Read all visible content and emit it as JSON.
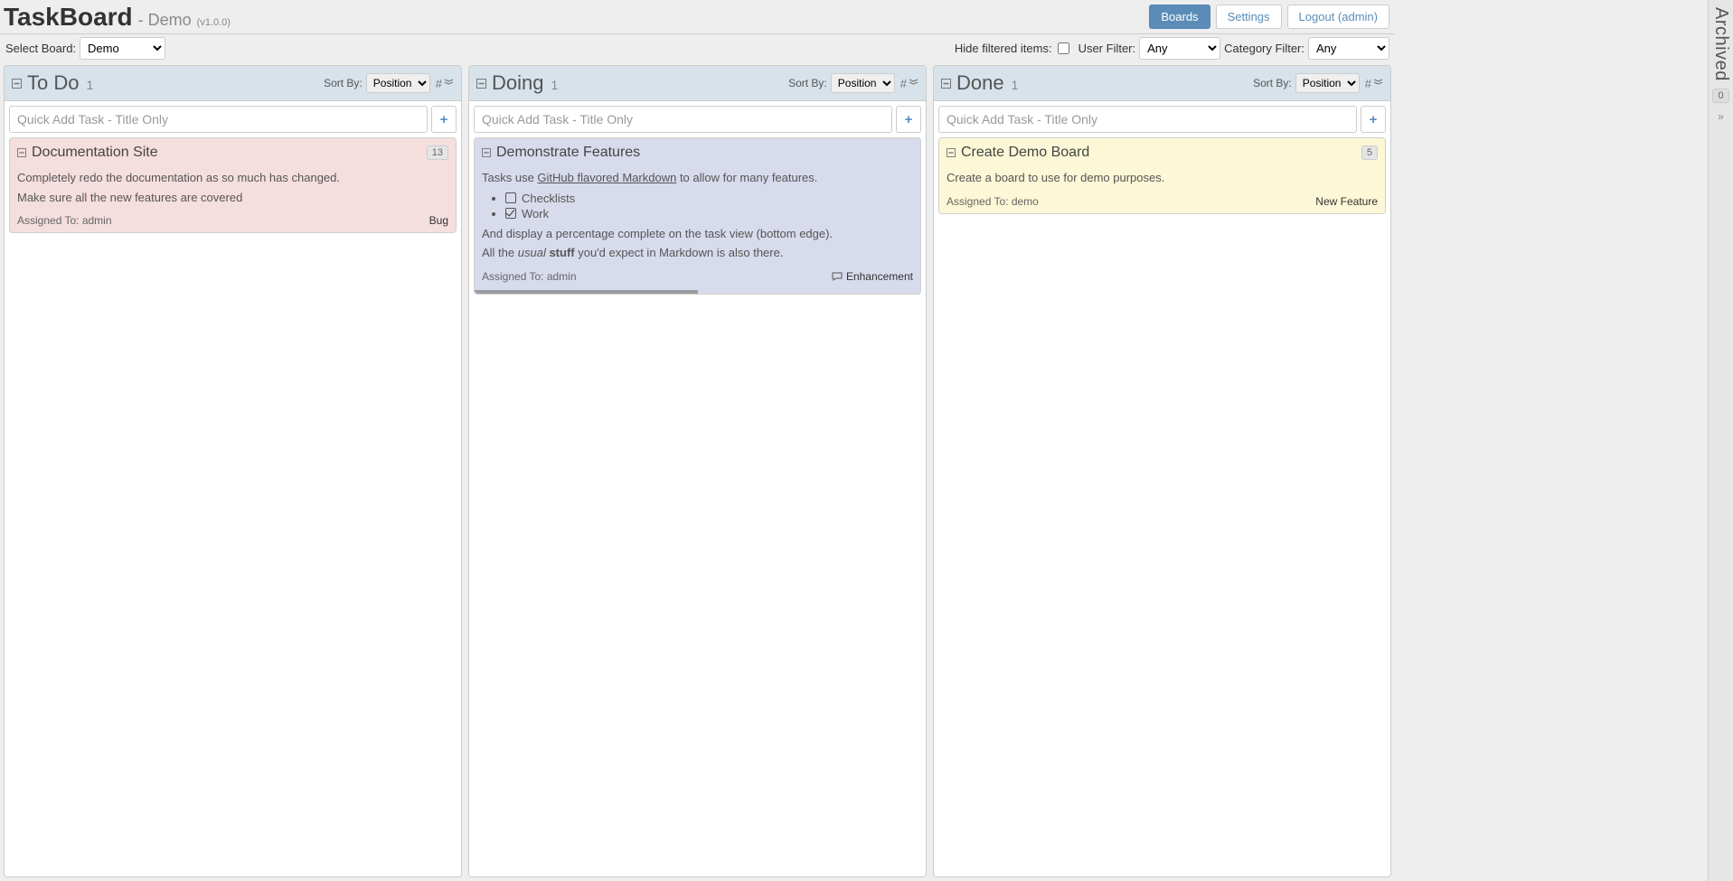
{
  "app": {
    "title": "TaskBoard",
    "board_name": "Demo",
    "version": "(v1.0.0)"
  },
  "nav": {
    "boards": "Boards",
    "settings": "Settings",
    "logout": "Logout (admin)"
  },
  "filters": {
    "select_board_label": "Select Board:",
    "select_board_value": "Demo",
    "hide_filtered_label": "Hide filtered items:",
    "user_filter_label": "User Filter:",
    "user_filter_value": "Any",
    "category_filter_label": "Category Filter:",
    "category_filter_value": "Any"
  },
  "sort_label": "Sort By:",
  "sort_value": "Position",
  "quick_add_placeholder": "Quick Add Task - Title Only",
  "columns": [
    {
      "title": "To Do",
      "count": "1",
      "card": {
        "title": "Documentation Site",
        "badge": "13",
        "p1": "Completely redo the documentation as so much has changed.",
        "p2": "Make sure all the new features are covered",
        "assigned": "Assigned To: admin",
        "tag": "Bug"
      }
    },
    {
      "title": "Doing",
      "count": "1",
      "card": {
        "title": "Demonstrate Features",
        "p1_a": "Tasks use ",
        "p1_link": "GitHub flavored Markdown",
        "p1_b": " to allow for many features.",
        "check1": "Checklists",
        "check2": "Work",
        "p2": "And display a percentage complete on the task view (bottom edge).",
        "p3_a": "All the ",
        "p3_em": "usual",
        "p3_b": " ",
        "p3_strong": "stuff",
        "p3_c": " you'd expect in Markdown is also there.",
        "assigned": "Assigned To: admin",
        "tag": "Enhancement",
        "progress_pct": 50
      }
    },
    {
      "title": "Done",
      "count": "1",
      "card": {
        "title": "Create Demo Board",
        "badge": "5",
        "p1": "Create a board to use for demo purposes.",
        "assigned": "Assigned To: demo",
        "tag": "New Feature"
      }
    }
  ],
  "archived": {
    "label": "Archived",
    "count": "0"
  }
}
